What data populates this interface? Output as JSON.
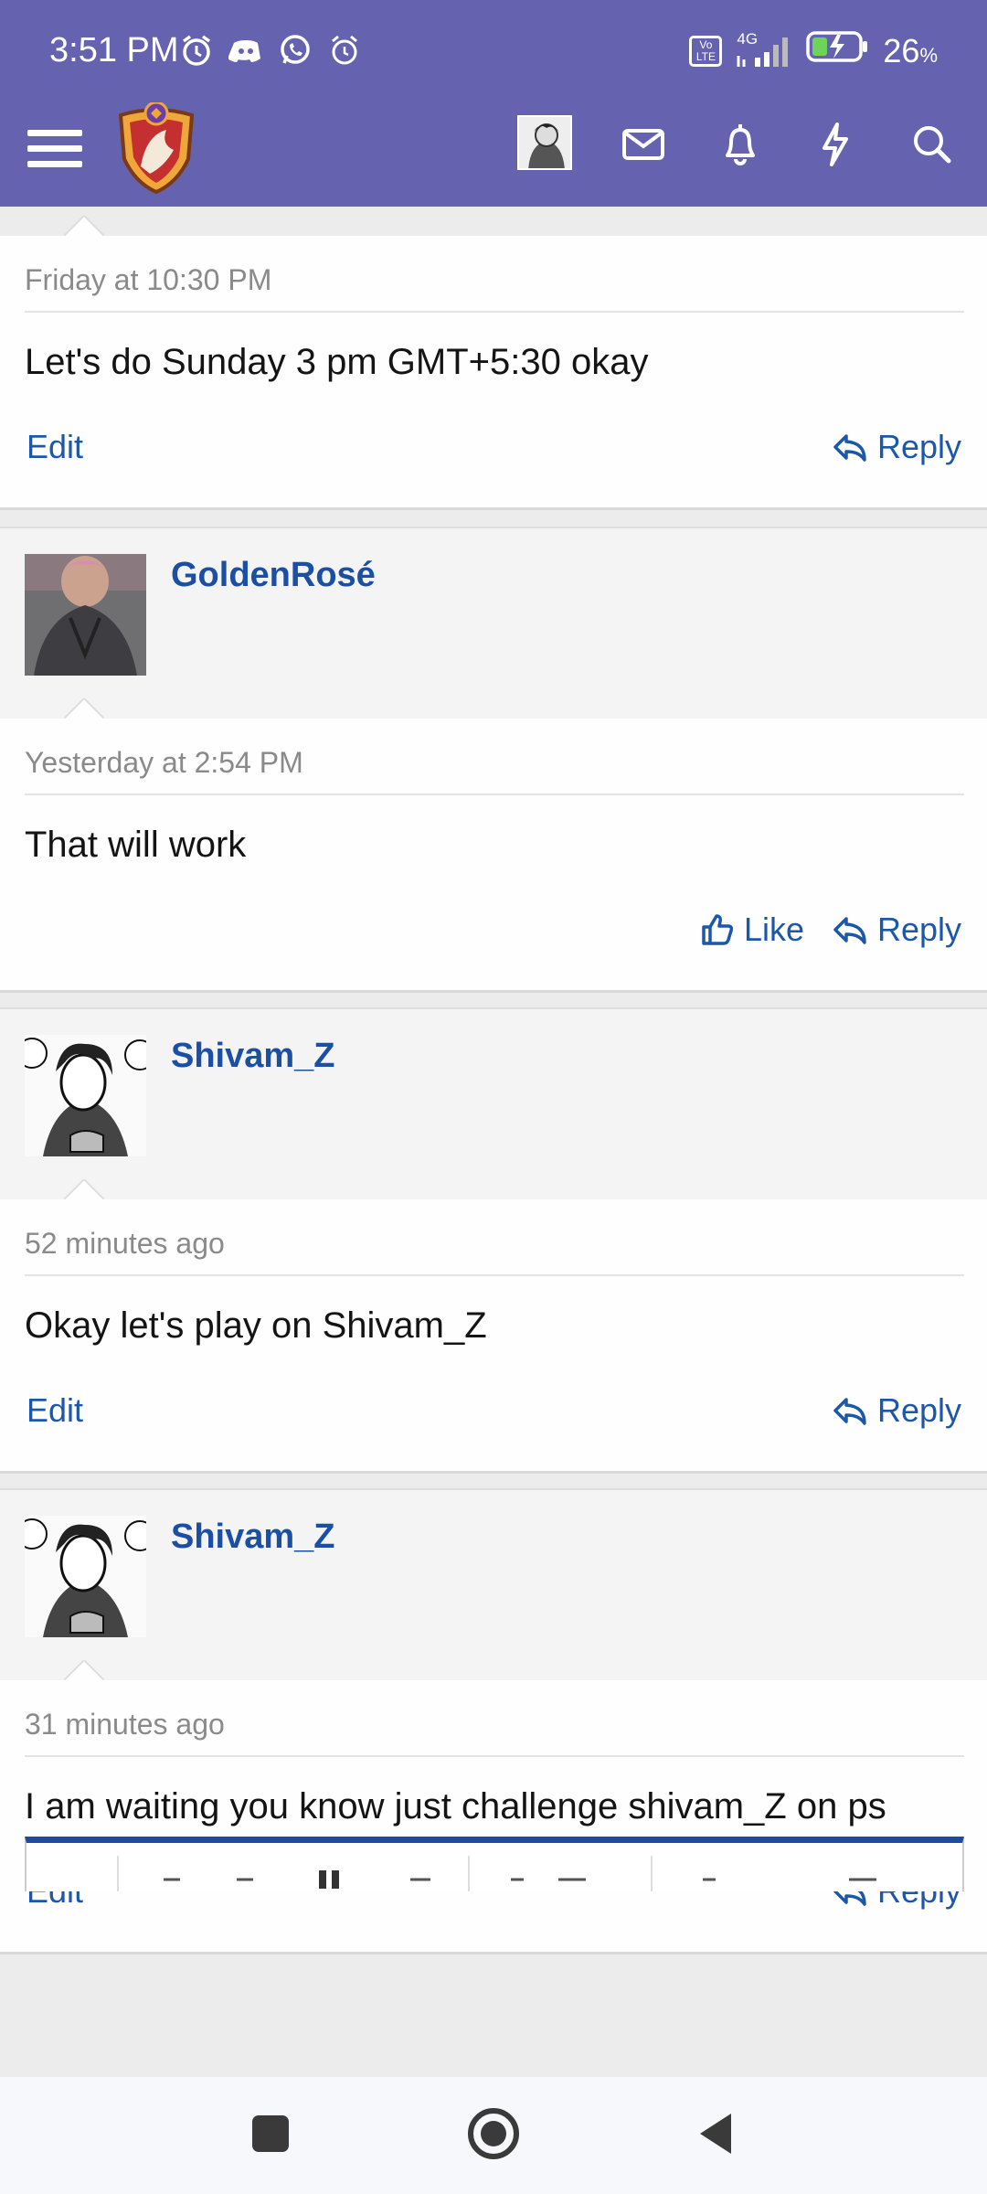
{
  "status": {
    "time": "3:51 PM",
    "battery": "26",
    "battery_unit": "%",
    "network": "4G",
    "volte": "Vo LTE"
  },
  "header": {
    "menu_icon": "hamburger-icon",
    "icons": [
      "mail-icon",
      "bell-icon",
      "bolt-icon",
      "search-icon"
    ]
  },
  "posts": [
    {
      "author": "",
      "date": "Friday at 10:30 PM",
      "message": "Let's do Sunday 3 pm GMT+5:30 okay",
      "left_action": "Edit",
      "reply": "Reply"
    },
    {
      "author": "GoldenRosé",
      "date": "Yesterday at 2:54 PM",
      "message": "That will work",
      "like": "Like",
      "reply": "Reply"
    },
    {
      "author": "Shivam_Z",
      "date": "52 minutes ago",
      "message": "Okay let's play on Shivam_Z",
      "left_action": "Edit",
      "reply": "Reply"
    },
    {
      "author": "Shivam_Z",
      "date": "31 minutes ago",
      "message": "I am waiting you know just challenge shivam_Z on ps",
      "left_action": "Edit",
      "reply": "Reply"
    }
  ],
  "colors": {
    "brand": "#6562b0",
    "link": "#1d57a8",
    "editor_accent": "#1f4a9e"
  }
}
